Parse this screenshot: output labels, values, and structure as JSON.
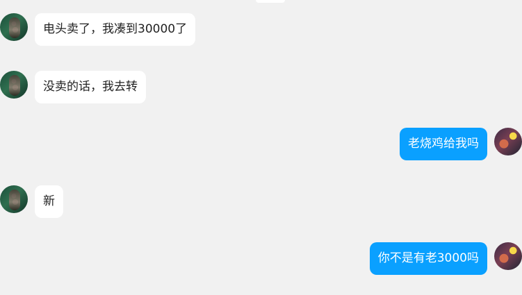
{
  "messages": [
    {
      "side": "left",
      "text": "电头卖了，我凑到30000了"
    },
    {
      "side": "left",
      "text": "没卖的话，我去转"
    },
    {
      "side": "right",
      "text": "老烧鸡给我吗"
    },
    {
      "side": "left",
      "text": "新"
    },
    {
      "side": "right",
      "text": "你不是有老3000吗"
    }
  ]
}
